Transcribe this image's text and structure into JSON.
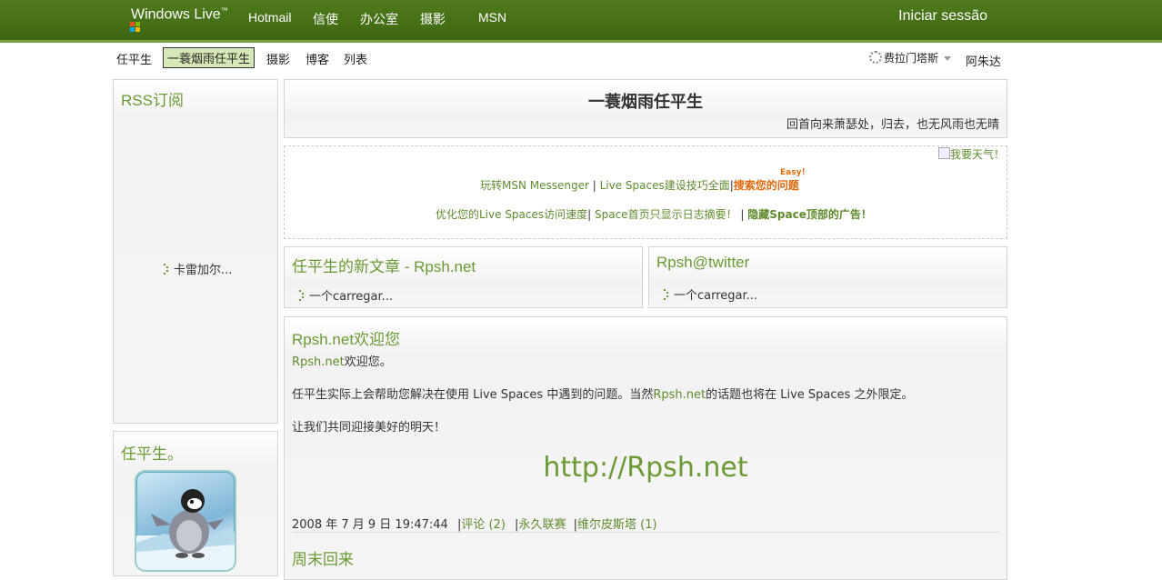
{
  "topbar": {
    "brand": "Windows Live",
    "tm": "™",
    "nav": [
      "Hotmail",
      "信使",
      "办公室",
      "摄影",
      "MSN"
    ],
    "signin": "Iniciar sessão"
  },
  "subnav": {
    "items": [
      "任平生",
      "一蓑烟雨任平生",
      "摄影",
      "博客",
      "列表"
    ],
    "owner": "费拉门塔斯",
    "user": "阿朱达"
  },
  "sidebar": {
    "rss_title": "RSS订阅",
    "rss_loading": "卡雷加尔...",
    "profile_title": "任平生。"
  },
  "header": {
    "title": "一蓑烟雨任平生",
    "subtitle": "回首向来萧瑟处，归去，也无风雨也无晴"
  },
  "notice": {
    "image_alt": "我要天气！",
    "easy": "Easy！",
    "line1_a": "玩转MSN Messenger",
    "line1_sep1": " | ",
    "line1_b": "Live Spaces建设技巧全面",
    "line1_sep2": "|",
    "line1_c": "搜索您的问题",
    "line2_a": "优化您的Live Spaces访问速度",
    "line2_sep1": "| ",
    "line2_b": "Space首页只显示日志摘要！",
    "line2_sep2": " | ",
    "line2_c": "隐藏Space顶部的广告！"
  },
  "widgets": {
    "left_title": "任平生的新文章 - Rpsh.net",
    "left_loading": "一个carregar...",
    "right_title": "Rpsh@twitter",
    "right_loading": "一个carregar..."
  },
  "post": {
    "title": "Rpsh.net欢迎您",
    "p1_link": "Rpsh.net",
    "p1_text": "欢迎您。",
    "p2_a": "任平生实际上会帮助您解决在使用 Live Spaces 中遇到的问题。当然",
    "p2_link": "Rpsh.net",
    "p2_b": "的话题也将在 Live Spaces 之外限定。",
    "p3": "让我们共同迎接美好的明天！",
    "big_url": "http://Rpsh.net",
    "date": "2008 年 7 月 9 日 19:47:44",
    "comments": "评论 (2)",
    "permalink": "永久联赛",
    "trackback": "维尔皮斯塔 (1)",
    "next_title": "周末回来"
  },
  "colors": {
    "topbar": "#4a7618",
    "accent": "#6a9a34",
    "orange": "#e06a10"
  }
}
